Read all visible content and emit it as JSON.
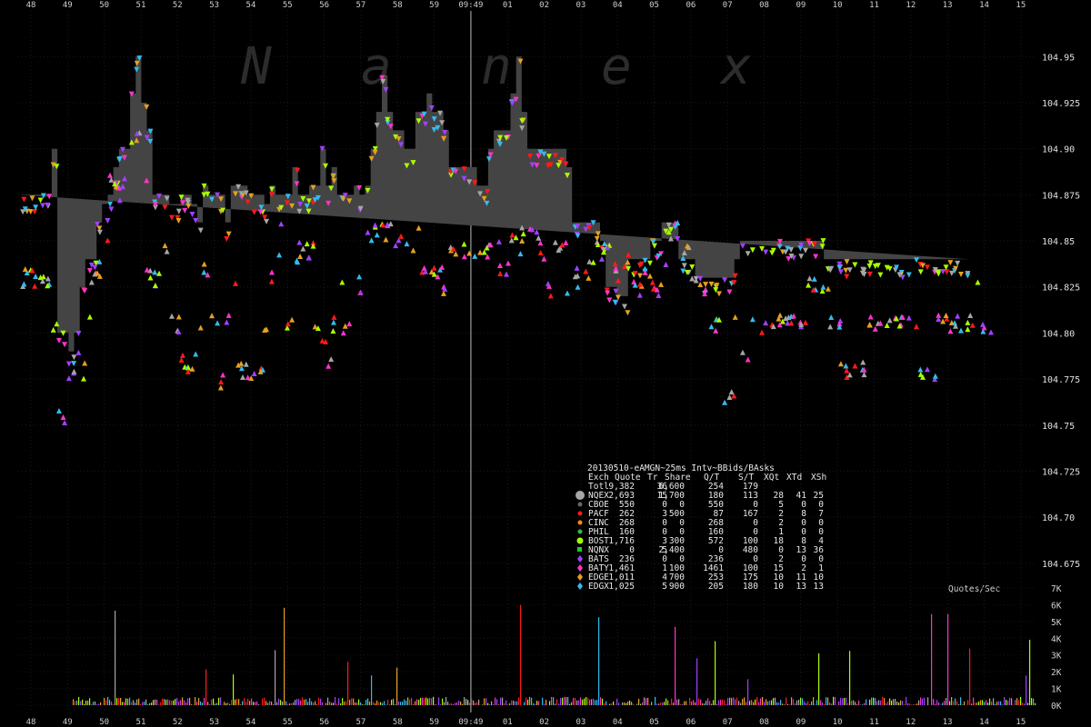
{
  "chart_data": {
    "type": "scatter",
    "watermark": [
      "N",
      "a",
      "n",
      "e",
      "x"
    ],
    "x_ticks": [
      "48",
      "49",
      "50",
      "51",
      "52",
      "53",
      "54",
      "55",
      "56",
      "57",
      "58",
      "59",
      "09:49",
      "01",
      "02",
      "03",
      "04",
      "05",
      "06",
      "07",
      "08",
      "09",
      "10",
      "11",
      "12",
      "13",
      "14",
      "15"
    ],
    "x_ticks_bottom": [
      "48",
      "49",
      "50",
      "51",
      "52",
      "53",
      "54",
      "55",
      "56",
      "57",
      "58",
      "59",
      "09:49",
      "01",
      "02",
      "03",
      "04",
      "05",
      "06",
      "07",
      "08",
      "09",
      "10",
      "11",
      "12",
      "13",
      "14",
      "15"
    ],
    "highlight_tick": "09:49",
    "y_price_ticks": [
      "104.95",
      "104.925",
      "104.90",
      "104.875",
      "104.85",
      "104.825",
      "104.80",
      "104.775",
      "104.75",
      "104.725",
      "104.70",
      "104.675"
    ],
    "y_price_values": [
      104.95,
      104.925,
      104.9,
      104.875,
      104.85,
      104.825,
      104.8,
      104.775,
      104.75,
      104.725,
      104.7,
      104.675
    ],
    "y_price_lim": [
      104.67,
      104.96
    ],
    "y_qps_label": "Quotes/Sec",
    "y_qps_ticks": [
      "7K",
      "6K",
      "5K",
      "4K",
      "3K",
      "2K",
      "1K",
      "0K"
    ],
    "y_qps_values": [
      7000,
      6000,
      5000,
      4000,
      3000,
      2000,
      1000,
      0
    ],
    "nbbo_series": {
      "name": "NBBO",
      "color": "#444444",
      "x_min_offset": [
        0,
        0.15,
        0.3,
        0.45,
        0.6,
        0.75,
        0.9,
        1.05,
        1.2,
        1.35,
        1.5,
        1.65,
        1.8,
        1.95,
        2.1,
        2.25,
        2.4,
        2.55,
        2.7,
        2.85,
        3.0,
        3.15,
        3.3,
        3.45,
        3.6,
        3.75,
        3.9,
        4.05,
        4.2,
        4.35,
        4.5,
        4.65,
        4.8,
        4.95,
        5.1,
        5.25,
        5.4,
        5.55,
        5.7,
        5.85,
        6.0,
        6.15,
        6.3,
        6.45,
        6.6,
        6.75,
        6.9,
        7.05,
        7.2,
        7.35,
        7.5,
        7.65,
        7.8,
        7.95,
        8.1,
        8.25,
        8.4,
        8.55,
        8.7,
        8.85,
        9.0,
        9.15,
        9.3,
        9.45,
        9.6,
        9.75,
        9.9,
        10.05,
        10.2,
        10.35,
        10.5,
        10.65,
        10.8,
        10.95,
        11.1,
        11.25,
        11.4,
        11.55,
        11.7,
        11.85,
        12.0,
        12.15,
        12.3,
        12.45,
        12.6,
        12.75,
        12.9,
        13.05,
        13.2,
        13.35,
        13.5,
        13.65,
        13.8,
        13.95,
        14.1,
        14.25,
        14.4,
        14.55,
        14.7,
        14.85,
        15.0,
        15.15,
        15.3,
        15.45,
        15.6,
        15.75,
        15.9,
        16.05,
        16.2,
        16.35,
        16.5,
        16.65,
        16.8,
        16.95,
        17.1,
        17.25,
        17.4,
        17.55,
        17.7,
        17.85,
        18.0,
        18.15,
        18.3,
        18.45,
        18.6,
        18.75,
        18.9,
        19.05,
        19.2,
        19.35,
        19.5,
        19.65,
        19.8,
        19.95,
        20.1,
        20.25,
        20.4,
        20.55,
        20.7,
        20.85,
        21.0,
        21.15,
        21.3,
        21.45,
        21.6,
        21.75,
        21.9,
        22.05,
        22.2,
        22.35,
        22.5,
        22.65,
        22.8,
        22.95,
        23.1,
        23.25,
        23.4,
        23.55,
        23.7,
        23.85,
        24.0,
        24.15,
        24.3,
        24.45,
        24.6,
        24.75,
        24.9,
        25.05,
        25.2,
        25.35,
        25.5,
        25.65,
        25.8,
        25.95,
        26.1,
        26.25,
        26.4,
        26.55,
        26.7,
        26.85,
        27.0,
        27.15,
        27.3
      ],
      "bid": [
        104.825,
        104.825,
        104.825,
        104.825,
        104.825,
        104.825,
        104.8,
        104.75,
        104.75,
        104.775,
        104.785,
        104.775,
        104.8,
        104.825,
        104.83,
        104.85,
        104.88,
        104.875,
        104.87,
        104.875,
        104.9,
        104.9,
        104.875,
        104.83,
        104.825,
        104.825,
        104.84,
        104.8,
        104.8,
        104.78,
        104.775,
        104.78,
        104.8,
        104.83,
        104.8,
        104.8,
        104.77,
        104.8,
        104.82,
        104.78,
        104.775,
        104.775,
        104.775,
        104.775,
        104.8,
        104.825,
        104.84,
        104.85,
        104.8,
        104.83,
        104.84,
        104.84,
        104.84,
        104.8,
        104.79,
        104.78,
        104.8,
        104.82,
        104.8,
        104.8,
        104.825,
        104.82,
        104.85,
        104.85,
        104.85,
        104.85,
        104.85,
        104.84,
        104.85,
        104.84,
        104.84,
        104.85,
        104.83,
        104.83,
        104.83,
        104.83,
        104.82,
        104.84,
        104.84,
        104.84,
        104.84,
        104.84,
        104.84,
        104.84,
        104.84,
        104.84,
        104.83,
        104.83,
        104.85,
        104.84,
        104.85,
        104.85,
        104.85,
        104.84,
        104.82,
        104.82,
        104.84,
        104.84,
        104.82,
        104.83,
        104.825,
        104.825,
        104.83,
        104.84,
        104.84,
        104.84,
        104.83,
        104.825,
        104.83,
        104.84,
        104.82,
        104.82,
        104.83,
        104.82,
        104.82,
        104.83,
        104.85,
        104.85,
        104.84,
        104.84,
        104.82,
        104.82,
        104.82,
        104.8,
        104.8,
        104.8,
        104.76,
        104.76,
        104.8,
        104.78,
        104.78,
        104.8,
        104.8,
        104.8,
        104.8,
        104.8,
        104.8,
        104.8,
        104.8,
        104.8,
        104.8,
        104.82,
        104.82,
        104.82,
        104.82,
        104.8,
        104.8,
        104.775,
        104.775,
        104.775,
        104.775,
        104.775,
        104.8,
        104.8,
        104.8,
        104.8,
        104.8,
        104.8,
        104.8,
        104.8,
        104.8,
        104.775,
        104.775,
        104.775,
        104.8,
        104.8,
        104.8,
        104.8,
        104.8,
        104.8,
        104.8,
        104.82,
        104.8,
        104.8
      ],
      "ask": [
        104.875,
        104.875,
        104.875,
        104.875,
        104.875,
        104.875,
        104.9,
        104.8,
        104.8,
        104.79,
        104.8,
        104.825,
        104.84,
        104.84,
        104.86,
        104.87,
        104.875,
        104.89,
        104.9,
        104.9,
        104.93,
        104.95,
        104.925,
        104.91,
        104.875,
        104.875,
        104.875,
        104.87,
        104.87,
        104.875,
        104.875,
        104.87,
        104.86,
        104.88,
        104.875,
        104.875,
        104.875,
        104.86,
        104.88,
        104.88,
        104.88,
        104.875,
        104.875,
        104.875,
        104.87,
        104.88,
        104.875,
        104.875,
        104.875,
        104.89,
        104.875,
        104.875,
        104.88,
        104.88,
        104.9,
        104.88,
        104.89,
        104.875,
        104.875,
        104.875,
        104.88,
        104.875,
        104.88,
        104.9,
        104.92,
        104.94,
        104.92,
        104.91,
        104.91,
        104.9,
        104.9,
        104.92,
        104.92,
        104.93,
        104.92,
        104.92,
        104.91,
        104.89,
        104.89,
        104.89,
        104.89,
        104.89,
        104.88,
        104.88,
        104.9,
        104.91,
        104.91,
        104.91,
        104.93,
        104.95,
        104.92,
        104.9,
        104.9,
        104.9,
        104.9,
        104.9,
        104.9,
        104.9,
        104.89,
        104.86,
        104.86,
        104.86,
        104.86,
        104.86,
        104.85,
        104.825,
        104.825,
        104.82,
        104.82,
        104.84,
        104.84,
        104.84,
        104.84,
        104.85,
        104.85,
        104.86,
        104.86,
        104.86,
        104.84,
        104.84,
        104.84,
        104.83,
        104.83,
        104.83,
        104.83,
        104.83,
        104.83,
        104.83,
        104.84,
        104.85,
        104.85,
        104.85,
        104.85,
        104.85,
        104.85,
        104.85,
        104.85,
        104.85,
        104.85,
        104.85,
        104.85,
        104.85,
        104.85,
        104.85,
        104.84,
        104.84,
        104.84,
        104.84,
        104.84,
        104.84,
        104.84,
        104.84,
        104.84,
        104.84,
        104.84,
        104.84,
        104.84,
        104.84,
        104.84,
        104.84,
        104.84,
        104.84,
        104.84,
        104.84,
        104.84,
        104.84,
        104.84,
        104.84,
        104.84,
        104.84
      ]
    },
    "stats_table": {
      "title": "20130510-eAMGN~25ms Intv~BBids/BAsks",
      "columns": [
        "Exch",
        "Quote",
        "Tr",
        "Share",
        "Q/T",
        "S/T",
        "XQt",
        "XTd",
        "XSh"
      ],
      "rows": [
        {
          "exch": "Totl",
          "quote": "9,382",
          "tr": "36",
          "share": "6,600",
          "qt": "254",
          "st": "179",
          "xqt": "",
          "xtd": "",
          "xsh": "",
          "color": "",
          "marker": "none"
        },
        {
          "exch": "NQEX",
          "quote": "2,693",
          "tr": "15",
          "share": "1,700",
          "qt": "180",
          "st": "113",
          "xqt": "28",
          "xtd": "41",
          "xsh": "25",
          "color": "#a6a6a6",
          "marker": "circle-large"
        },
        {
          "exch": "CBOE",
          "quote": "550",
          "tr": "0",
          "share": "0",
          "qt": "550",
          "st": "0",
          "xqt": "5",
          "xtd": "0",
          "xsh": "0",
          "color": "#666666",
          "marker": "dot"
        },
        {
          "exch": "PACF",
          "quote": "262",
          "tr": "3",
          "share": "500",
          "qt": "87",
          "st": "167",
          "xqt": "2",
          "xtd": "8",
          "xsh": "7",
          "color": "#ff1a1a",
          "marker": "dot"
        },
        {
          "exch": "CINC",
          "quote": "268",
          "tr": "0",
          "share": "0",
          "qt": "268",
          "st": "0",
          "xqt": "2",
          "xtd": "0",
          "xsh": "0",
          "color": "#ff8c00",
          "marker": "dot"
        },
        {
          "exch": "PHIL",
          "quote": "160",
          "tr": "0",
          "share": "0",
          "qt": "160",
          "st": "0",
          "xqt": "1",
          "xtd": "0",
          "xsh": "0",
          "color": "#3cb44b",
          "marker": "dot"
        },
        {
          "exch": "BOST",
          "quote": "1,716",
          "tr": "3",
          "share": "300",
          "qt": "572",
          "st": "100",
          "xqt": "18",
          "xtd": "8",
          "xsh": "4",
          "color": "#aaff00",
          "marker": "circle"
        },
        {
          "exch": "NQNX",
          "quote": "0",
          "tr": "5",
          "share": "2,400",
          "qt": "0",
          "st": "480",
          "xqt": "0",
          "xtd": "13",
          "xsh": "36",
          "color": "#22cc22",
          "marker": "square"
        },
        {
          "exch": "BATS",
          "quote": "236",
          "tr": "0",
          "share": "0",
          "qt": "236",
          "st": "0",
          "xqt": "2",
          "xtd": "0",
          "xsh": "0",
          "color": "#a040ff",
          "marker": "diamond"
        },
        {
          "exch": "BATY",
          "quote": "1,461",
          "tr": "1",
          "share": "100",
          "qt": "1461",
          "st": "100",
          "xqt": "15",
          "xtd": "2",
          "xsh": "1",
          "color": "#ff33cc",
          "marker": "diamond"
        },
        {
          "exch": "EDGE",
          "quote": "1,011",
          "tr": "4",
          "share": "700",
          "qt": "253",
          "st": "175",
          "xqt": "10",
          "xtd": "11",
          "xsh": "10",
          "color": "#e6a020",
          "marker": "diamond"
        },
        {
          "exch": "EDGX",
          "quote": "1,025",
          "tr": "5",
          "share": "900",
          "qt": "205",
          "st": "180",
          "xqt": "10",
          "xtd": "13",
          "xsh": "13",
          "color": "#33bbee",
          "marker": "diamond"
        }
      ]
    },
    "exchange_colors": [
      "#a6a6a6",
      "#33bbee",
      "#e6a020",
      "#ff33cc",
      "#aaff00",
      "#a040ff",
      "#ff1a1a"
    ]
  }
}
